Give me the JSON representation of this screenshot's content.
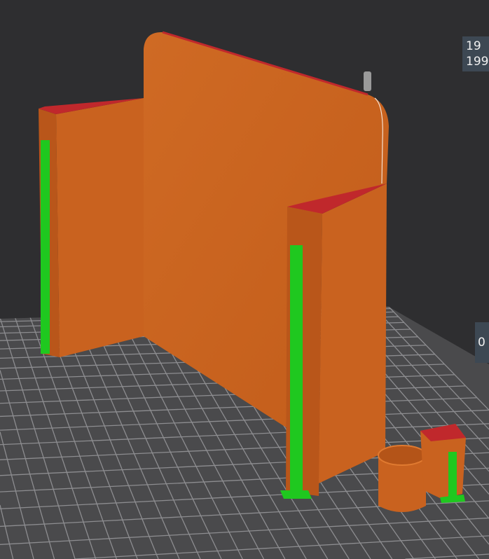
{
  "viewer": {
    "layer_slider_top": {
      "upper": "19",
      "lower": "199"
    },
    "layer_slider_bottom": {
      "value": "0"
    }
  },
  "colors": {
    "background": "#2e2e30",
    "bed": "#4a4a4c",
    "bed_grid": "#8d8d90",
    "perimeter": "#c8621e",
    "top_edge": "#c0282c",
    "support": "#1fc81f",
    "label_bg": "#3d4853"
  }
}
